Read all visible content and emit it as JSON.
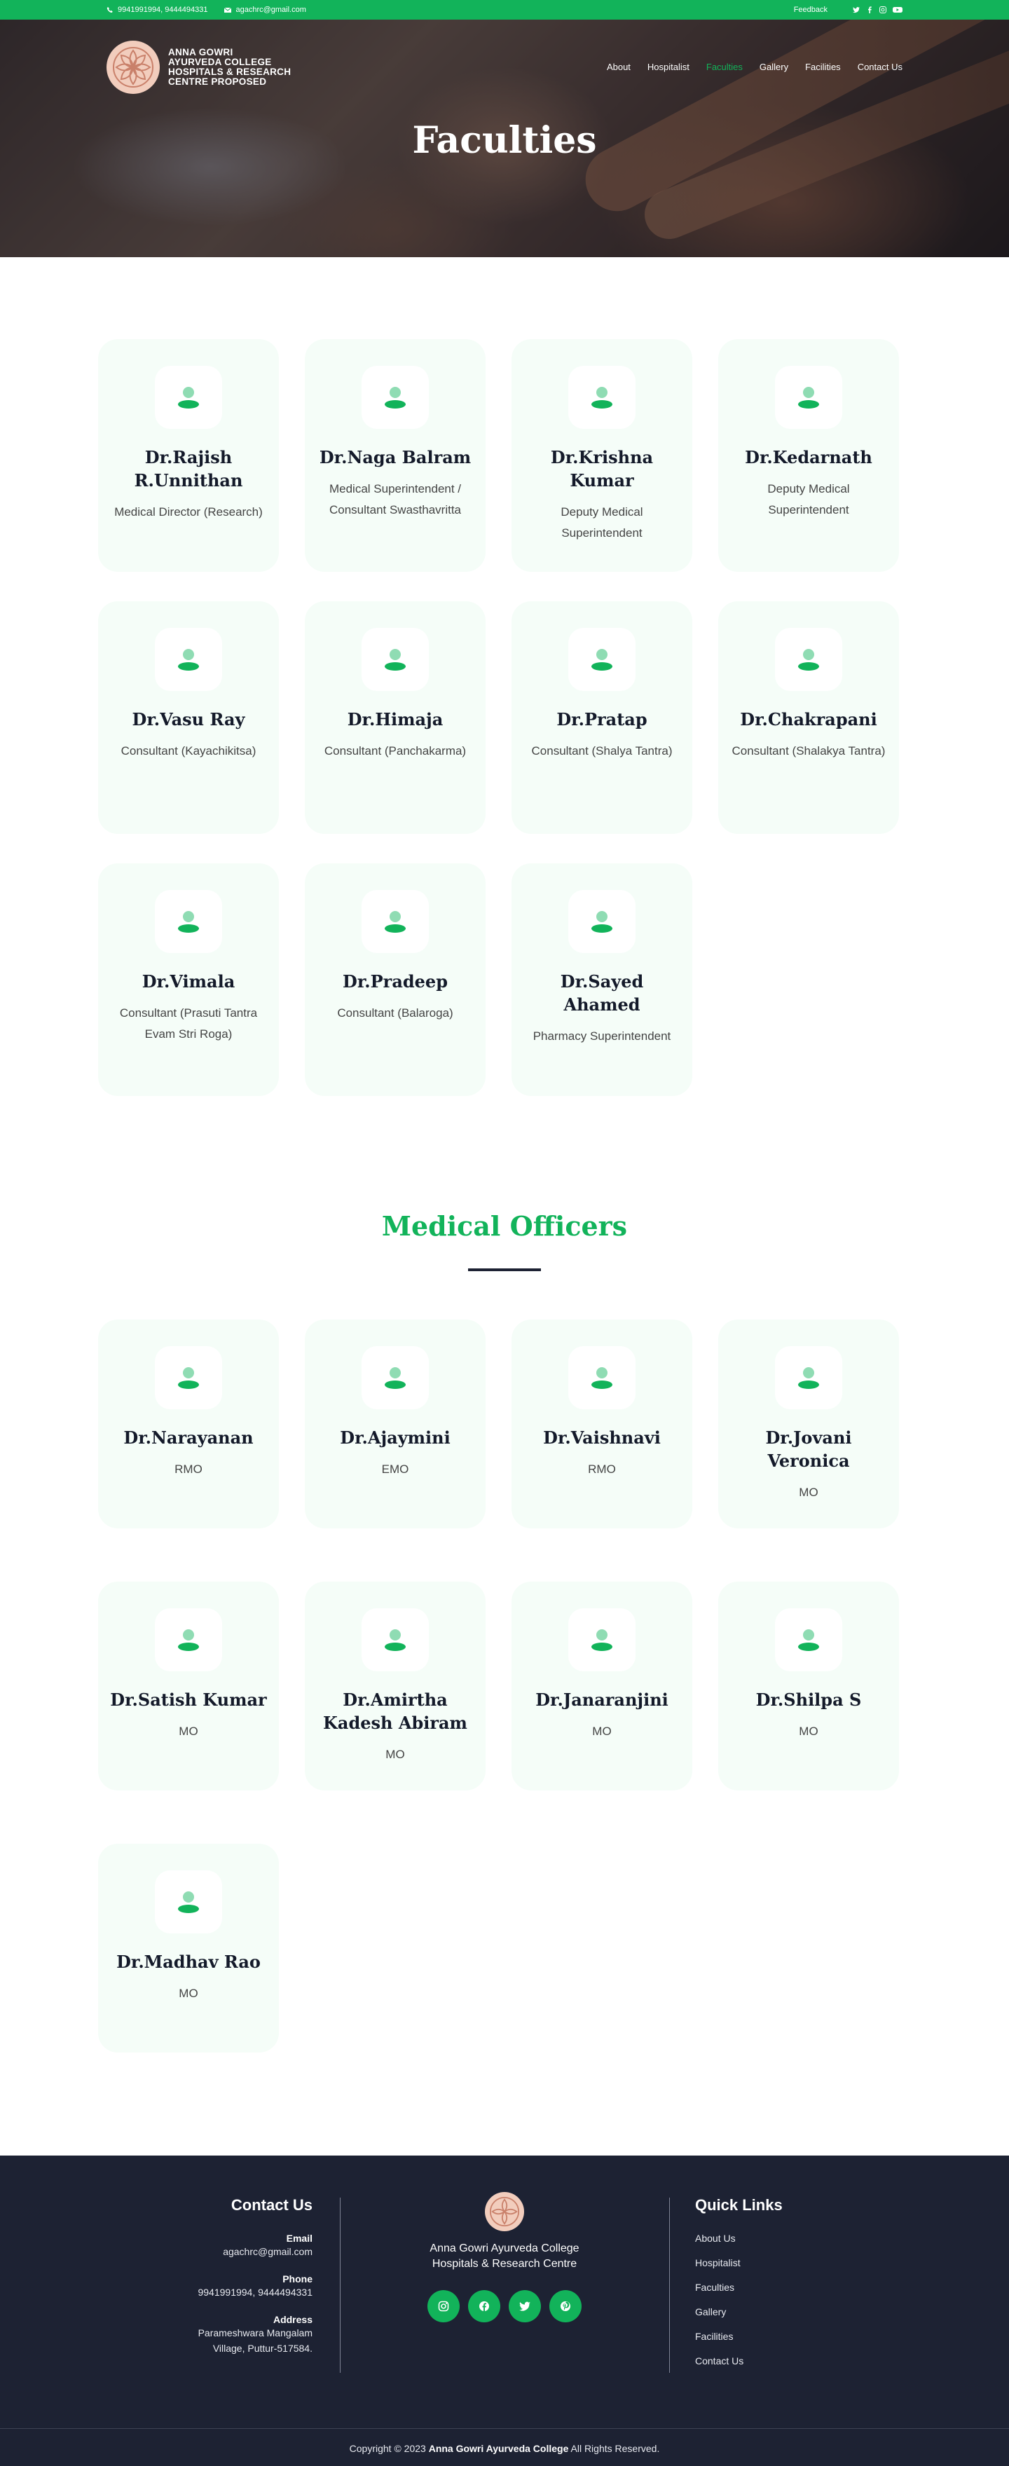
{
  "topbar": {
    "phone": "9941991994, 9444494331",
    "email": "agachrc@gmail.com",
    "feedback": "Feedback",
    "social_icons": [
      "twitter-icon",
      "facebook-icon",
      "instagram-icon",
      "youtube-icon"
    ]
  },
  "header": {
    "logo_lines": [
      "ANNA GOWRI",
      "AYURVEDA COLLEGE",
      "HOSPITALS & RESEARCH",
      "CENTRE PROPOSED"
    ],
    "nav": [
      "About",
      "Hospitalist",
      "Faculties",
      "Gallery",
      "Facilities",
      "Contact Us"
    ],
    "active_nav": "Faculties",
    "page_title": "Faculties"
  },
  "faculties": [
    {
      "name": "Dr.Rajish R.Unnithan",
      "role": "Medical Director (Research)"
    },
    {
      "name": "Dr.Naga Balram",
      "role": "Medical Superintendent / Consultant Swasthavritta"
    },
    {
      "name": "Dr.Krishna Kumar",
      "role": "Deputy Medical Superintendent"
    },
    {
      "name": "Dr.Kedarnath",
      "role": "Deputy Medical Superintendent"
    },
    {
      "name": "Dr.Vasu Ray",
      "role": "Consultant (Kayachikitsa)"
    },
    {
      "name": "Dr.Himaja",
      "role": "Consultant (Panchakarma)"
    },
    {
      "name": "Dr.Pratap",
      "role": "Consultant (Shalya Tantra)"
    },
    {
      "name": "Dr.Chakrapani",
      "role": "Consultant (Shalakya Tantra)"
    },
    {
      "name": "Dr.Vimala",
      "role": "Consultant (Prasuti Tantra Evam Stri Roga)"
    },
    {
      "name": "Dr.Pradeep",
      "role": "Consultant (Balaroga)"
    },
    {
      "name": "Dr.Sayed Ahamed",
      "role": "Pharmacy Superintendent"
    }
  ],
  "medical_officers_title": "Medical Officers",
  "medical_officers": [
    {
      "name": "Dr.Narayanan",
      "role": "RMO"
    },
    {
      "name": "Dr.Ajaymini",
      "role": "EMO"
    },
    {
      "name": "Dr.Vaishnavi",
      "role": "RMO"
    },
    {
      "name": "Dr.Jovani Veronica",
      "role": "MO"
    },
    {
      "name": "Dr.Satish Kumar",
      "role": "MO"
    },
    {
      "name": "Dr.Amirtha Kadesh Abiram",
      "role": "MO"
    },
    {
      "name": "Dr.Janaranjini",
      "role": "MO"
    },
    {
      "name": "Dr.Shilpa S",
      "role": "MO"
    },
    {
      "name": "Dr.Madhav Rao",
      "role": "MO"
    }
  ],
  "footer": {
    "contact_title": "Contact Us",
    "email_label": "Email",
    "email": "agachrc@gmail.com",
    "phone_label": "Phone",
    "phone": "9941991994, 9444494331",
    "address_label": "Address",
    "address_line1": "Parameshwara Mangalam",
    "address_line2": "Village, Puttur-517584.",
    "college_line1": "Anna Gowri Ayurveda College",
    "college_line2": "Hospitals & Research Centre",
    "social_icons": [
      "instagram-icon",
      "facebook-icon",
      "twitter-icon",
      "pinterest-icon"
    ],
    "quick_links_title": "Quick Links",
    "quick_links": [
      "About Us",
      "Hospitalist",
      "Faculties",
      "Gallery",
      "Facilities",
      "Contact Us"
    ],
    "copyright_prefix": "Copyright © 2023",
    "copyright_name": "Anna Gowri Ayurveda College",
    "copyright_suffix": "All Rights Reserved."
  },
  "colors": {
    "accent": "#12b35a",
    "dark": "#1d2233",
    "card_bg": "#f5fdf8"
  }
}
